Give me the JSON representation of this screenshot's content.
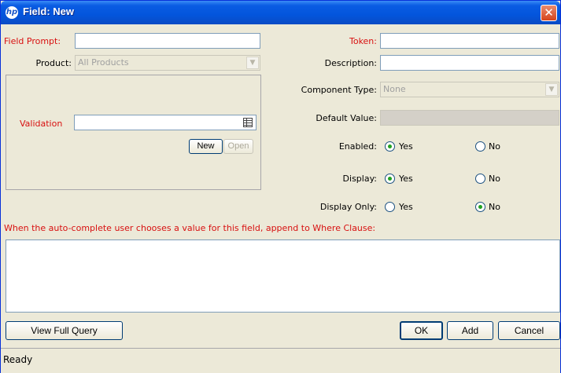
{
  "window": {
    "title": "Field: New",
    "logo_text": "hp",
    "close_label": "✕"
  },
  "form": {
    "field_prompt": {
      "label": "Field Prompt:",
      "value": ""
    },
    "product": {
      "label": "Product:",
      "value": "All Products"
    },
    "validation": {
      "label": "Validation",
      "value": ""
    },
    "new_button": "New",
    "open_button": "Open",
    "token": {
      "label": "Token:",
      "value": ""
    },
    "description": {
      "label": "Description:",
      "value": ""
    },
    "component_type": {
      "label": "Component Type:",
      "value": "None"
    },
    "default_value": {
      "label": "Default Value:",
      "value": ""
    },
    "enabled": {
      "label": "Enabled:",
      "yes": "Yes",
      "no": "No",
      "selected": "Yes"
    },
    "display": {
      "label": "Display:",
      "yes": "Yes",
      "no": "No",
      "selected": "Yes"
    },
    "display_only": {
      "label": "Display Only:",
      "yes": "Yes",
      "no": "No",
      "selected": "No"
    },
    "where_clause_label": "When the auto-complete user chooses a value for this field, append to Where Clause:",
    "where_clause_value": ""
  },
  "footer": {
    "view_full_query": "View Full Query",
    "ok": "OK",
    "add": "Add",
    "cancel": "Cancel"
  },
  "status": {
    "text": "Ready"
  },
  "colors": {
    "required_label": "#d81010",
    "titlebar": "#0a5ce3",
    "dialog_bg": "#ece9d8"
  }
}
